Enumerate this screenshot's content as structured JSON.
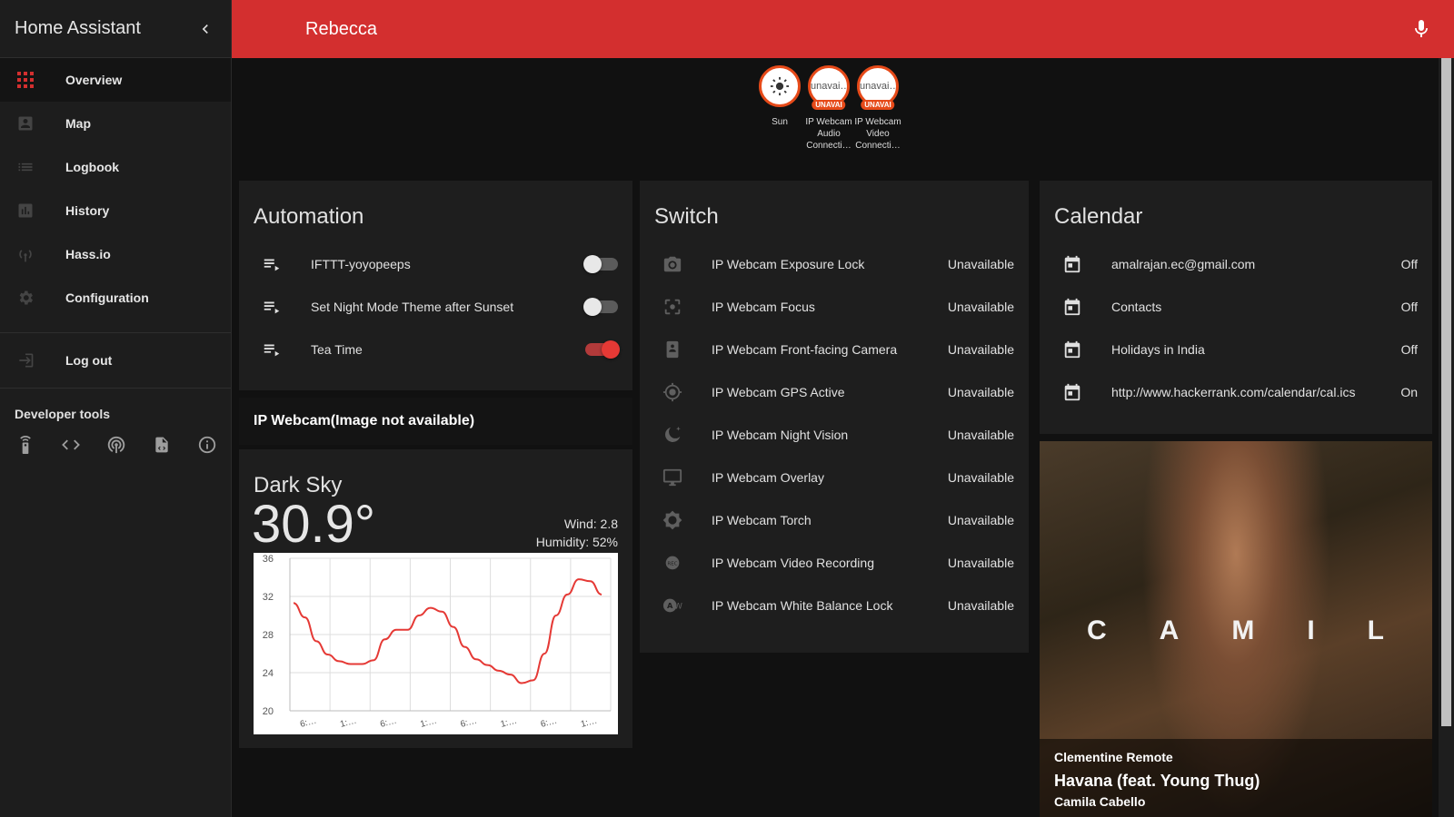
{
  "app": {
    "title": "Home Assistant"
  },
  "sidebar": {
    "items": [
      {
        "label": "Overview",
        "icon": "apps-grid-icon",
        "active": true
      },
      {
        "label": "Map",
        "icon": "account-box-icon"
      },
      {
        "label": "Logbook",
        "icon": "list-icon"
      },
      {
        "label": "History",
        "icon": "chart-box-icon"
      },
      {
        "label": "Hass.io",
        "icon": "antenna-icon"
      },
      {
        "label": "Configuration",
        "icon": "gear-icon"
      }
    ],
    "logout_label": "Log out",
    "dev_tools_title": "Developer tools",
    "dev_tools": [
      "remote-icon",
      "code-icon",
      "broadcast-icon",
      "file-code-icon",
      "info-icon"
    ]
  },
  "topbar": {
    "title": "Rebecca",
    "accent": "#d32f2f"
  },
  "badges": [
    {
      "label": "Sun",
      "value": "",
      "icon": "sun-icon"
    },
    {
      "label": "IP Webcam Audio Connecti…",
      "value": "unavai…",
      "tag": "UNAVAI"
    },
    {
      "label": "IP Webcam Video Connecti…",
      "value": "unavai…",
      "tag": "UNAVAI"
    }
  ],
  "automation": {
    "title": "Automation",
    "rows": [
      {
        "name": "IFTTT-yoyopeeps",
        "on": false
      },
      {
        "name": "Set Night Mode Theme after Sunset",
        "on": false
      },
      {
        "name": "Tea Time",
        "on": true
      }
    ]
  },
  "camera": {
    "label": "IP Webcam(Image not available)"
  },
  "weather": {
    "title": "Dark Sky",
    "temperature": "30.9°",
    "wind": "Wind: 2.8",
    "humidity": "Humidity: 52%"
  },
  "chart_data": {
    "type": "line",
    "title": "",
    "xlabel": "",
    "ylabel": "",
    "ylim": [
      20,
      36
    ],
    "y_ticks": [
      36,
      32,
      28,
      24,
      20
    ],
    "x_tick_labels": [
      "6:…",
      "1:…",
      "6:…",
      "1:…",
      "6:…",
      "1:…",
      "6:…",
      "1:…"
    ],
    "grid": true,
    "series": [
      {
        "color": "#e53935",
        "values": [
          31.3,
          29.8,
          27.3,
          25.9,
          25.2,
          24.9,
          24.9,
          25.3,
          27.5,
          28.5,
          28.5,
          30.0,
          30.8,
          30.4,
          28.8,
          26.7,
          25.4,
          24.8,
          24.2,
          23.8,
          22.9,
          23.2,
          26.0,
          30.0,
          32.2,
          33.8,
          33.6,
          32.2
        ]
      }
    ]
  },
  "switch": {
    "title": "Switch",
    "rows": [
      {
        "name": "IP Webcam Exposure Lock",
        "state": "Unavailable",
        "icon": "camera-icon"
      },
      {
        "name": "IP Webcam Focus",
        "state": "Unavailable",
        "icon": "focus-icon"
      },
      {
        "name": "IP Webcam Front-facing Camera",
        "state": "Unavailable",
        "icon": "camera-front-icon"
      },
      {
        "name": "IP Webcam GPS Active",
        "state": "Unavailable",
        "icon": "crosshairs-gps-icon"
      },
      {
        "name": "IP Webcam Night Vision",
        "state": "Unavailable",
        "icon": "night-icon"
      },
      {
        "name": "IP Webcam Overlay",
        "state": "Unavailable",
        "icon": "monitor-icon"
      },
      {
        "name": "IP Webcam Torch",
        "state": "Unavailable",
        "icon": "brightness-icon"
      },
      {
        "name": "IP Webcam Video Recording",
        "state": "Unavailable",
        "icon": "record-rec-icon"
      },
      {
        "name": "IP Webcam White Balance Lock",
        "state": "Unavailable",
        "icon": "white-balance-icon"
      }
    ]
  },
  "calendar": {
    "title": "Calendar",
    "rows": [
      {
        "name": "amalrajan.ec@gmail.com",
        "state": "Off"
      },
      {
        "name": "Contacts",
        "state": "Off"
      },
      {
        "name": "Holidays in India",
        "state": "Off"
      },
      {
        "name": "http://www.hackerrank.com/calendar/cal.ics",
        "state": "On"
      }
    ]
  },
  "media": {
    "album_text": "CAMILA",
    "player": "Clementine Remote",
    "track": "Havana (feat. Young Thug)",
    "artist": "Camila Cabello"
  }
}
